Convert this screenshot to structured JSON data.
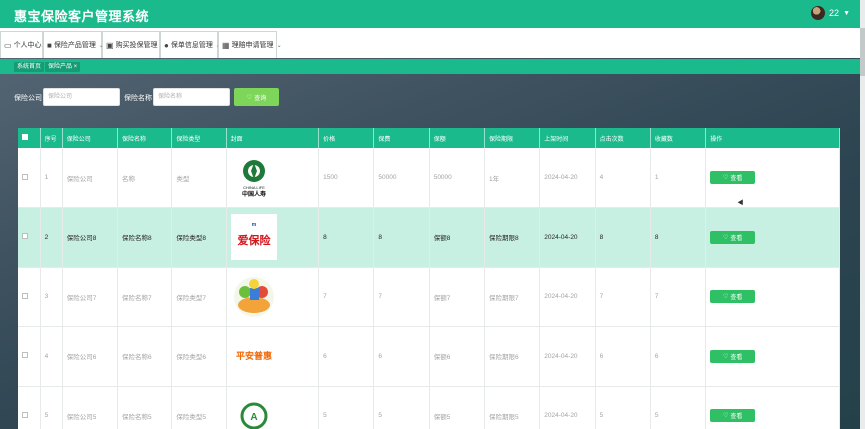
{
  "header": {
    "app_title": "惠宝保险客户管理系统",
    "username": "22",
    "avatar_icon": "user-avatar",
    "dropdown_icon": "caret-down-icon"
  },
  "nav": {
    "items": [
      {
        "label": "个人中心",
        "icon": "monitor-icon"
      },
      {
        "label": "保险产品管理",
        "icon": "database-icon"
      },
      {
        "label": "购买投保管理",
        "icon": "cart-icon"
      },
      {
        "label": "保单信息管理",
        "icon": "user-icon"
      },
      {
        "label": "理赔申请管理",
        "icon": "grid-icon"
      }
    ]
  },
  "tabs": {
    "items": [
      {
        "label": "系统首页"
      },
      {
        "label": "保险产品 ×"
      }
    ]
  },
  "search": {
    "company_label": "保险公司",
    "company_placeholder": "保险公司",
    "name_label": "保险名称",
    "name_placeholder": "保险名称",
    "button_label": "查询",
    "button_icon": "heart-icon"
  },
  "table": {
    "headers": [
      "",
      "序号",
      "保险公司",
      "保险名称",
      "保险类型",
      "封面",
      "价格",
      "保费",
      "保额",
      "保险期限",
      "上架时间",
      "点击次数",
      "收藏数",
      "操作"
    ],
    "rows": [
      {
        "index": "1",
        "company": "保险公司",
        "name": "名称",
        "type": "类型",
        "cover_text": "中国人寿",
        "price": "1500",
        "premium": "50000",
        "amount": "50000",
        "term": "1年",
        "date": "2024-04-20",
        "clicks": "4",
        "favorites": "1",
        "action": "查看"
      },
      {
        "index": "2",
        "company": "保险公司8",
        "name": "保险名称8",
        "type": "保险类型8",
        "cover_text": "爱保险",
        "price": "8",
        "premium": "8",
        "amount": "保额8",
        "term": "保险期限8",
        "date": "2024-04-20",
        "clicks": "8",
        "favorites": "8",
        "action": "查看"
      },
      {
        "index": "3",
        "company": "保险公司7",
        "name": "保险名称7",
        "type": "保险类型7",
        "cover_text": "",
        "price": "7",
        "premium": "7",
        "amount": "保额7",
        "term": "保险期限7",
        "date": "2024-04-20",
        "clicks": "7",
        "favorites": "7",
        "action": "查看"
      },
      {
        "index": "4",
        "company": "保险公司6",
        "name": "保险名称6",
        "type": "保险类型6",
        "cover_text": "平安普惠",
        "price": "6",
        "premium": "6",
        "amount": "保额6",
        "term": "保险期限6",
        "date": "2024-04-20",
        "clicks": "6",
        "favorites": "6",
        "action": "查看"
      },
      {
        "index": "5",
        "company": "保险公司5",
        "name": "保险名称5",
        "type": "保险类型5",
        "cover_text": "",
        "price": "5",
        "premium": "5",
        "amount": "保额5",
        "term": "保险期限5",
        "date": "2024-04-20",
        "clicks": "5",
        "favorites": "5",
        "action": "查看"
      }
    ]
  },
  "colors": {
    "primary": "#1aba8c",
    "highlight_row": "#c8f0e2",
    "action_button": "#2fbf65",
    "search_button": "#7dd55a"
  }
}
